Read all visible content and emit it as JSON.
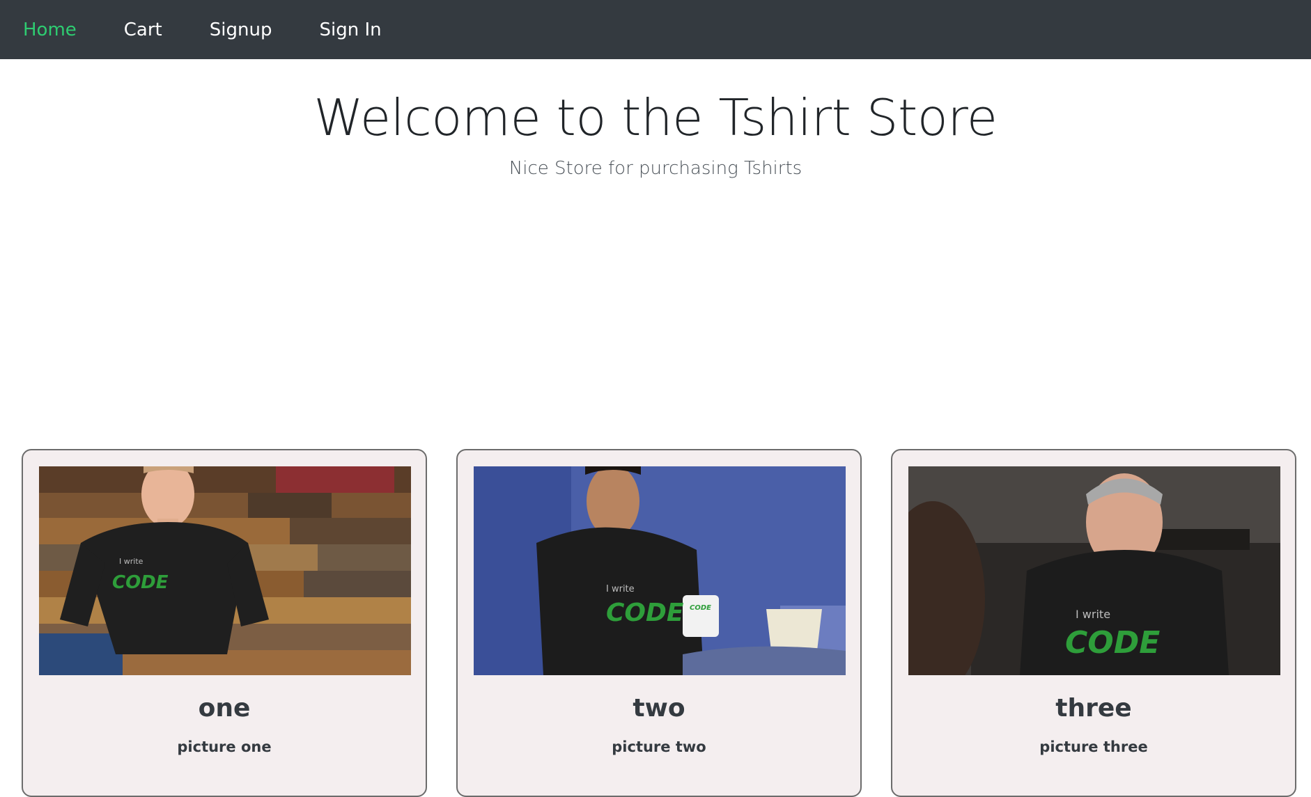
{
  "nav": {
    "items": [
      {
        "label": "Home",
        "active": true
      },
      {
        "label": "Cart",
        "active": false
      },
      {
        "label": "Signup",
        "active": false
      },
      {
        "label": "Sign In",
        "active": false
      }
    ],
    "active_color": "#2ecc71",
    "background": "#343a40"
  },
  "hero": {
    "title": "Welcome to the Tshirt Store",
    "subtitle": "Nice Store for purchasing Tshirts"
  },
  "cards": [
    {
      "title": "one",
      "text": "picture one",
      "image_icon": "man-in-code-tshirt-wood-wall-photo",
      "shirt_text_small": "I write",
      "shirt_text_big": "CODE"
    },
    {
      "title": "two",
      "text": "picture two",
      "image_icon": "man-with-mug-blue-wall-photo",
      "shirt_text_small": "I write",
      "shirt_text_big": "CODE",
      "mug_text": "CODE"
    },
    {
      "title": "three",
      "text": "picture three",
      "image_icon": "older-man-smiling-photo",
      "shirt_text_small": "I write",
      "shirt_text_big": "CODE"
    }
  ]
}
